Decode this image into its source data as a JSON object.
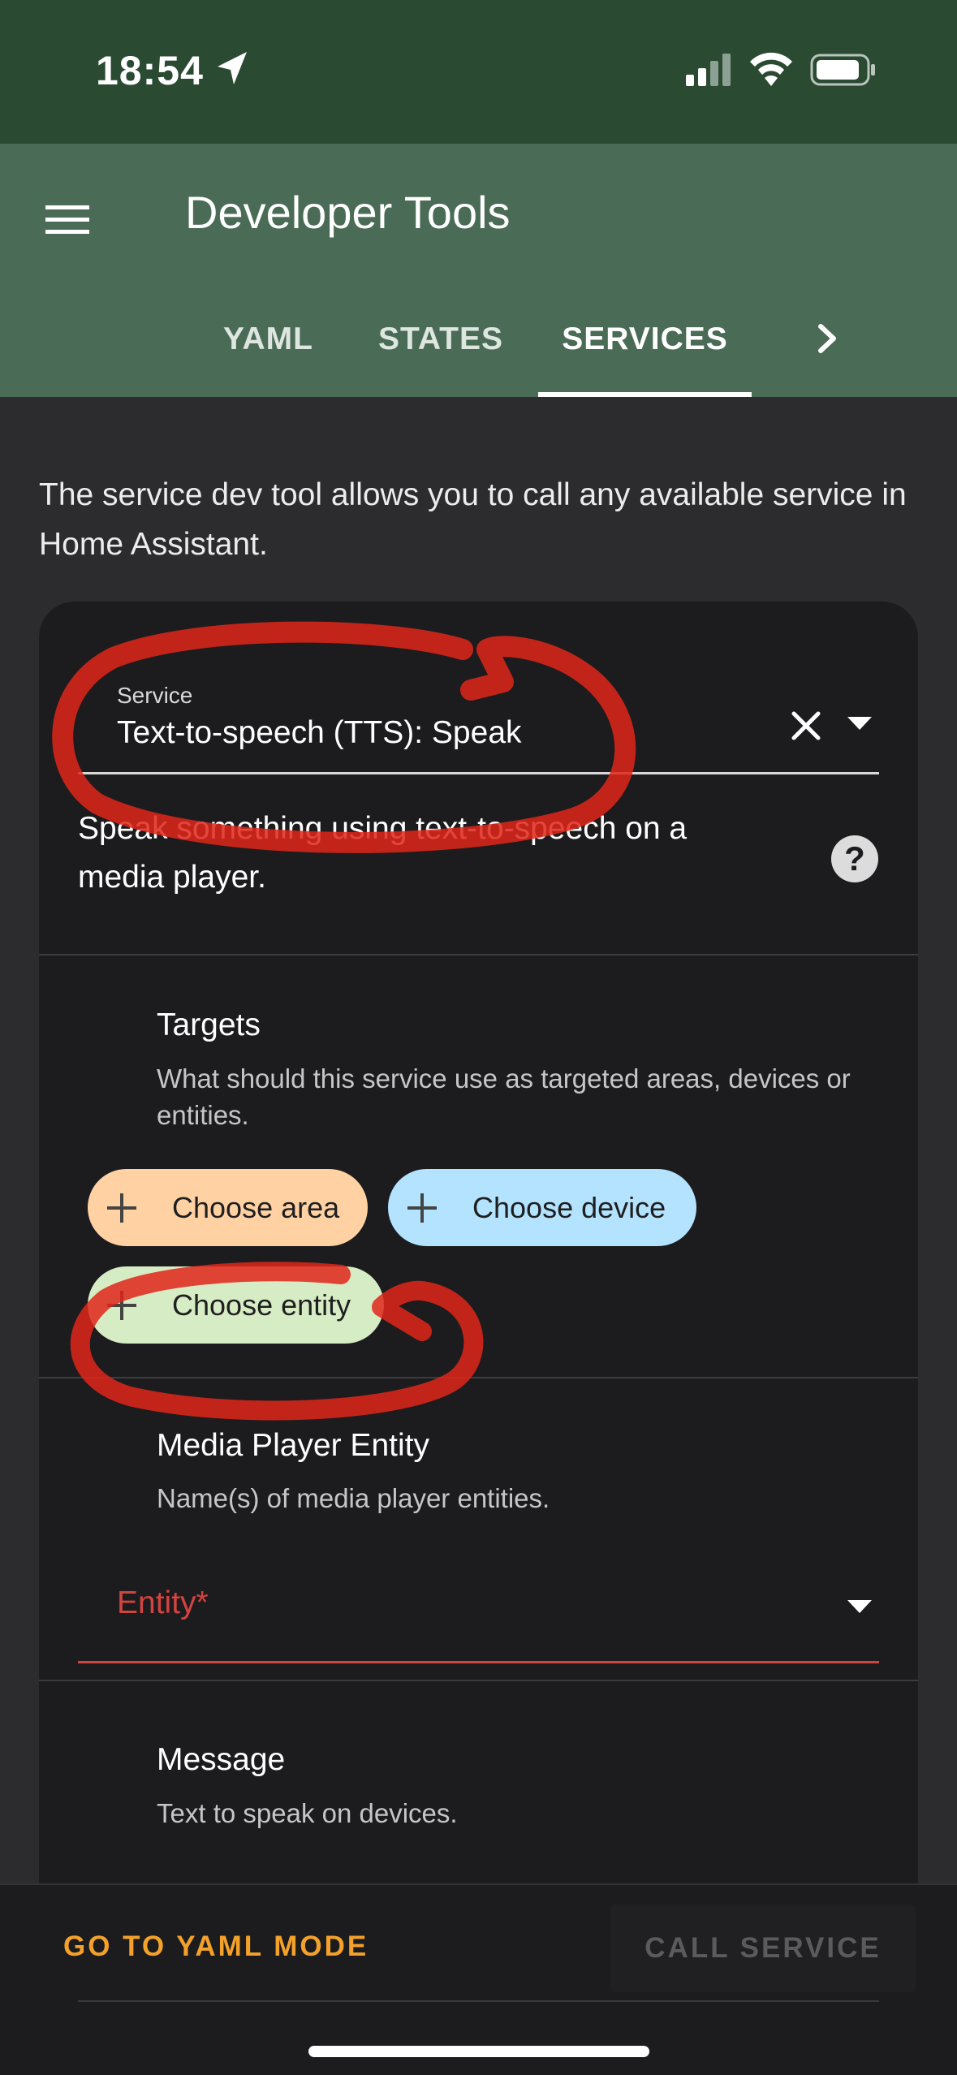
{
  "status_bar": {
    "time": "18:54",
    "icons": [
      "location-arrow-icon",
      "cellular-signal-icon",
      "wifi-icon",
      "battery-icon"
    ]
  },
  "app_bar": {
    "title": "Developer Tools",
    "menu_icon": "hamburger-menu-icon",
    "tabs": [
      {
        "label": "YAML",
        "active": false
      },
      {
        "label": "STATES",
        "active": false
      },
      {
        "label": "SERVICES",
        "active": true
      }
    ],
    "more_icon": "chevron-right-icon",
    "color": "#4a6b55"
  },
  "intro": "The service dev tool allows you to call any available service in Home Assistant.",
  "service": {
    "label": "Service",
    "value": "Text-to-speech (TTS): Speak",
    "description": "Speak something using text-to-speech on a media player."
  },
  "targets": {
    "title": "Targets",
    "description": "What should this service use as targeted areas, devices or entities.",
    "chips": {
      "area": "Choose area",
      "device": "Choose device",
      "entity": "Choose entity"
    }
  },
  "media_player": {
    "title": "Media Player Entity",
    "description": "Name(s) of media player entities.",
    "field_label": "Entity*"
  },
  "message": {
    "title": "Message",
    "description": "Text to speak on devices."
  },
  "actions": {
    "yaml_mode": "GO TO YAML MODE",
    "call_service": "CALL SERVICE"
  },
  "colors": {
    "accent_orange": "#f3a12a",
    "error_red": "#d3433f",
    "scribble_red": "#e0261a"
  }
}
